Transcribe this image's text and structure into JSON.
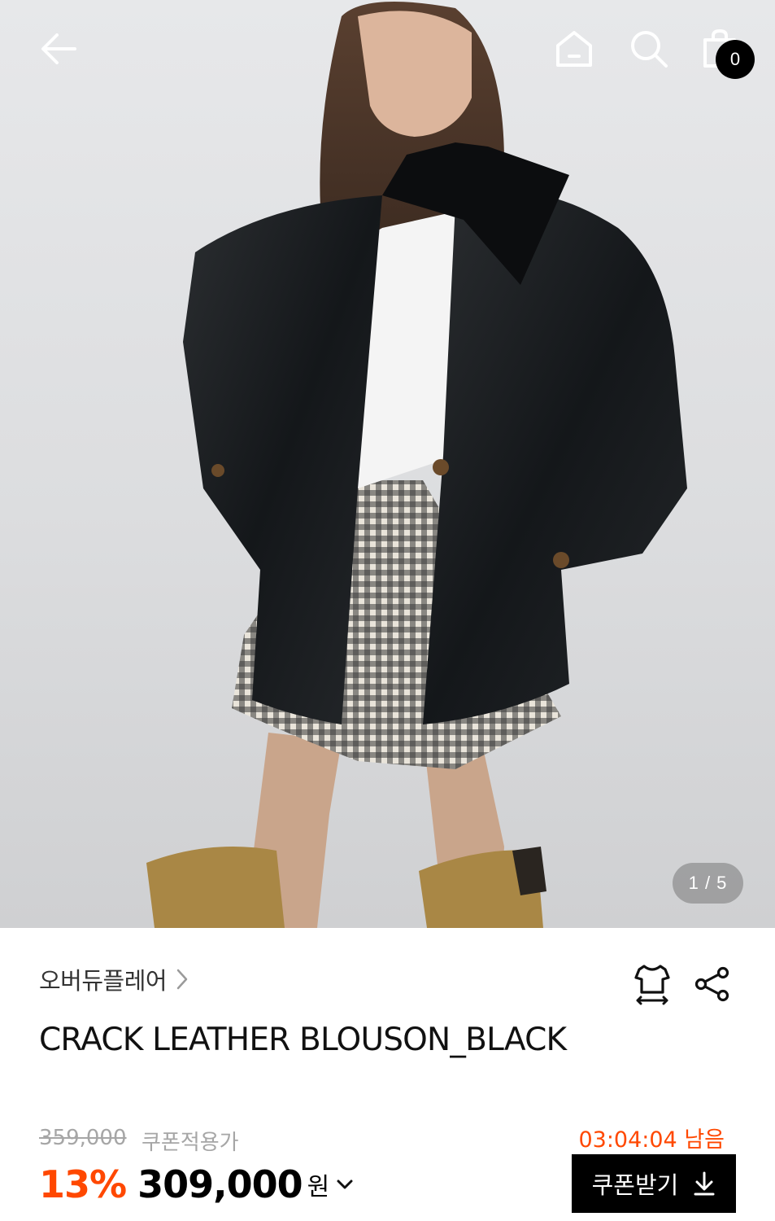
{
  "gallery": {
    "pager_text": "1 / 5",
    "current": 1,
    "total": 5
  },
  "header": {
    "back_icon": "arrow-left-icon",
    "home_icon": "home-icon",
    "search_icon": "search-icon",
    "cart_icon": "shopping-bag-icon",
    "cart_count": "0"
  },
  "product": {
    "brand": "오버듀플레어",
    "title": "CRACK LEATHER BLOUSON_BLACK",
    "size_icon": "size-guide-icon",
    "share_icon": "share-icon"
  },
  "pricing": {
    "original_price": "359,000",
    "coupon_label": "쿠폰적용가",
    "discount": "13%",
    "sale_price": "309,000",
    "currency": "원",
    "timer": "03:04:04 남음",
    "coupon_button_label": "쿠폰받기"
  },
  "colors": {
    "accent": "#ff4800",
    "muted": "#a6a6a6",
    "button_bg": "#000000"
  }
}
